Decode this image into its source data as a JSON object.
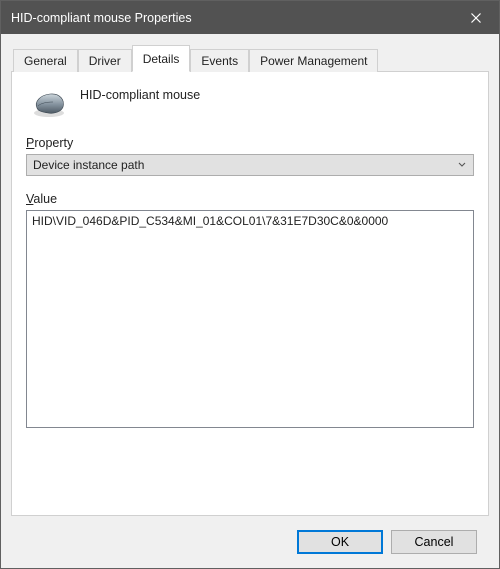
{
  "window": {
    "title": "HID-compliant mouse Properties"
  },
  "tabs": {
    "general": "General",
    "driver": "Driver",
    "details": "Details",
    "events": "Events",
    "power": "Power Management"
  },
  "device": {
    "name": "HID-compliant mouse"
  },
  "labels": {
    "property_prefix": "P",
    "property_rest": "roperty",
    "value_prefix": "V",
    "value_rest": "alue"
  },
  "property": {
    "selected": "Device instance path"
  },
  "value": {
    "text": "HID\\VID_046D&PID_C534&MI_01&COL01\\7&31E7D30C&0&0000"
  },
  "buttons": {
    "ok": "OK",
    "cancel": "Cancel"
  }
}
